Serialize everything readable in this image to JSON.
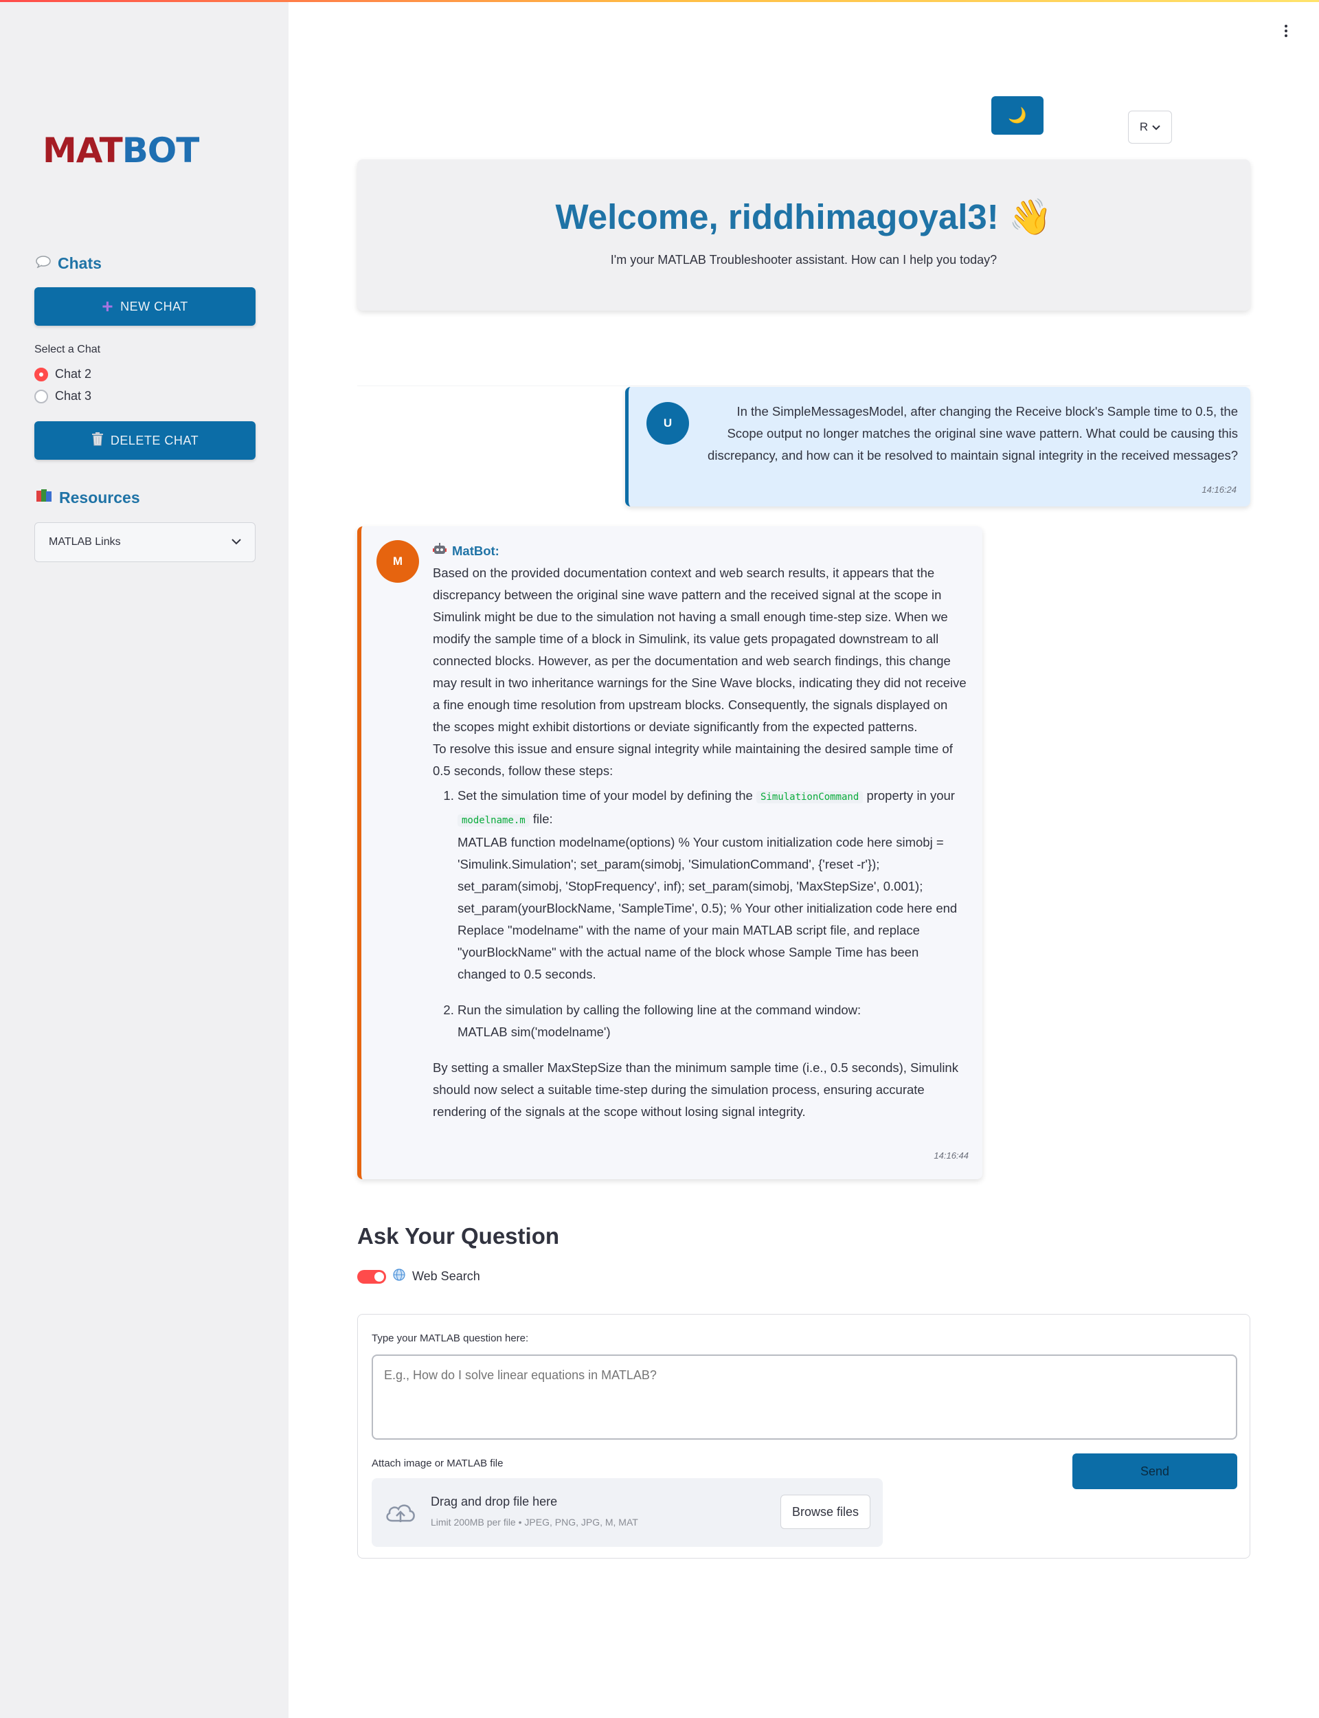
{
  "app": {
    "logo_prefix": "MAT",
    "logo_suffix": "BOT"
  },
  "sidebar": {
    "chats_title": "Chats",
    "new_chat_label": "NEW CHAT",
    "select_chat_label": "Select a Chat",
    "chats": [
      {
        "label": "Chat 2",
        "selected": true
      },
      {
        "label": "Chat 3",
        "selected": false
      }
    ],
    "delete_chat_label": "DELETE CHAT",
    "resources_title": "Resources",
    "resources_select_value": "MATLAB Links"
  },
  "header": {
    "theme_icon": "🌙",
    "language_value": "R"
  },
  "welcome": {
    "title": "Welcome, riddhimagoyal3!",
    "wave": "👋",
    "subtitle": "I'm your MATLAB Troubleshooter assistant. How can I help you today?"
  },
  "conversation": {
    "user": {
      "avatar": "U",
      "text": "In the SimpleMessagesModel, after changing the Receive block's Sample time to 0.5, the Scope output no longer matches the original sine wave pattern. What could be causing this discrepancy, and how can it be resolved to maintain signal integrity in the received messages?",
      "time": "14:16:24"
    },
    "bot": {
      "avatar": "M",
      "name": "MatBot:",
      "para1": "Based on the provided documentation context and web search results, it appears that the discrepancy between the original sine wave pattern and the received signal at the scope in Simulink might be due to the simulation not having a small enough time-step size. When we modify the sample time of a block in Simulink, its value gets propagated downstream to all connected blocks. However, as per the documentation and web search findings, this change may result in two inheritance warnings for the Sine Wave blocks, indicating they did not receive a fine enough time resolution from upstream blocks. Consequently, the signals displayed on the scopes might exhibit distortions or deviate significantly from the expected patterns.",
      "para2": "To resolve this issue and ensure signal integrity while maintaining the desired sample time of 0.5 seconds, follow these steps:",
      "step1_a": "Set the simulation time of your model by defining the",
      "step1_code1": "SimulationCommand",
      "step1_b": "property in your",
      "step1_code2": "modelname.m",
      "step1_c": "file:",
      "step1_code": "MATLAB function modelname(options) % Your custom initialization code here simobj = 'Simulink.Simulation'; set_param(simobj, 'SimulationCommand', {'reset -r'}); set_param(simobj, 'StopFrequency', inf); set_param(simobj, 'MaxStepSize', 0.001); set_param(yourBlockName, 'SampleTime', 0.5); % Your other initialization code here end",
      "step1_note": "Replace \"modelname\" with the name of your main MATLAB script file, and replace \"yourBlockName\" with the actual name of the block whose Sample Time has been changed to 0.5 seconds.",
      "step2_a": "Run the simulation by calling the following line at the command window:",
      "step2_b": "MATLAB sim('modelname')",
      "para3": "By setting a smaller MaxStepSize than the minimum sample time (i.e., 0.5 seconds), Simulink should now select a suitable time-step during the simulation process, ensuring accurate rendering of the signals at the scope without losing signal integrity.",
      "time": "14:16:44"
    }
  },
  "ask": {
    "title": "Ask Your Question",
    "web_search_label": "Web Search",
    "web_search_on": true,
    "question_label": "Type your MATLAB question here:",
    "question_placeholder": "E.g., How do I solve linear equations in MATLAB?",
    "question_value": "",
    "attach_label": "Attach image or MATLAB file",
    "drop_main": "Drag and drop file here",
    "drop_sub": "Limit 200MB per file • JPEG, PNG, JPG, M, MAT",
    "browse_label": "Browse files",
    "send_label": "Send"
  },
  "colors": {
    "primary": "#0c6da7",
    "accent_orange": "#e6640f",
    "toggle_red": "#ff4b4b",
    "logo_red": "#a51c24"
  }
}
